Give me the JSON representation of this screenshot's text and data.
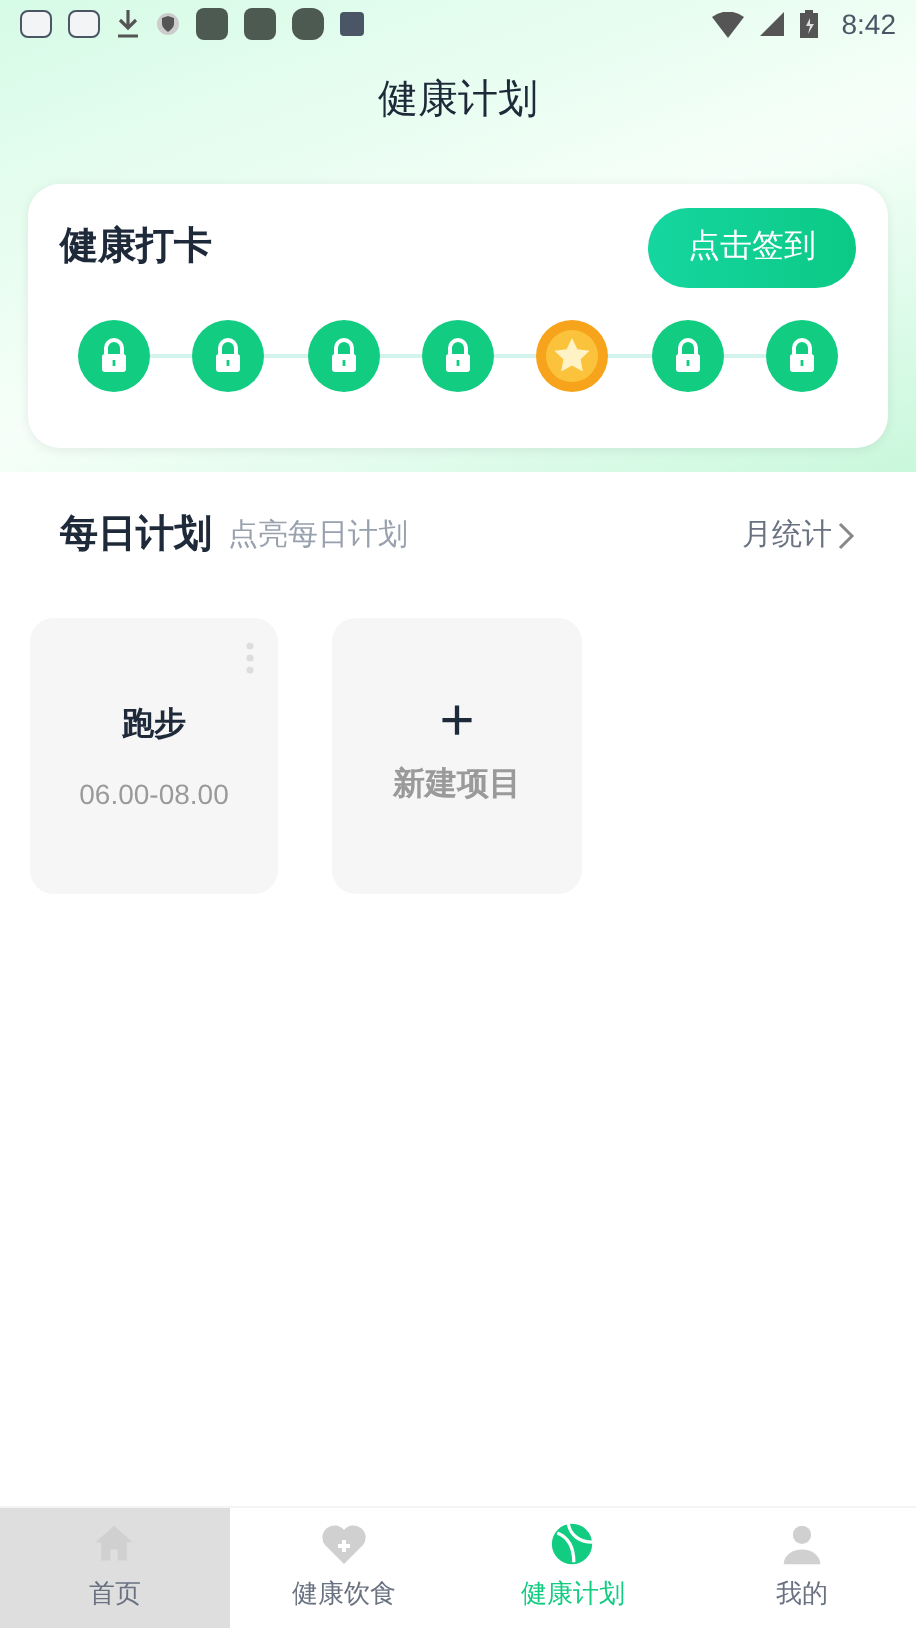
{
  "status_bar": {
    "time": "8:42"
  },
  "title": "健康计划",
  "checkin": {
    "title": "健康打卡",
    "button": "点击签到",
    "days": [
      {
        "kind": "locked"
      },
      {
        "kind": "locked"
      },
      {
        "kind": "locked"
      },
      {
        "kind": "locked"
      },
      {
        "kind": "star"
      },
      {
        "kind": "locked"
      },
      {
        "kind": "locked"
      }
    ]
  },
  "daily_plan": {
    "title": "每日计划",
    "subtitle": "点亮每日计划",
    "link": "月统计",
    "items": [
      {
        "kind": "plan",
        "name": "跑步",
        "time": "06.00-08.00"
      },
      {
        "kind": "add",
        "icon": "+",
        "label": "新建项目"
      }
    ]
  },
  "nav": [
    {
      "label": "首页",
      "kind": "home",
      "selected": false,
      "pressed": true
    },
    {
      "label": "健康饮食",
      "kind": "heart",
      "selected": false,
      "pressed": false
    },
    {
      "label": "健康计划",
      "kind": "ball",
      "selected": true,
      "pressed": false
    },
    {
      "label": "我的",
      "kind": "person",
      "selected": false,
      "pressed": false
    }
  ]
}
